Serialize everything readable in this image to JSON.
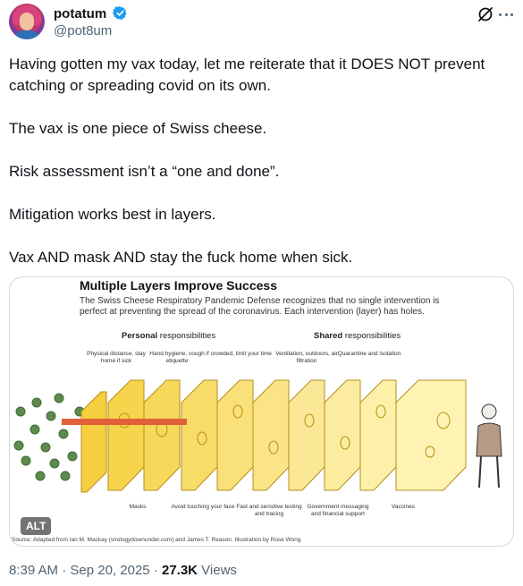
{
  "author": {
    "display_name": "potatum",
    "handle": "@pot8um",
    "verified_icon": "verified-badge-icon",
    "avatar_icon": "avatar"
  },
  "header_actions": {
    "grok_icon": "grok-icon",
    "more_icon": "more-options-icon"
  },
  "tweet": {
    "paragraphs": [
      "Having gotten my vax today, let me reiterate that it DOES NOT prevent catching or spreading covid on its own.",
      "The vax is one piece of Swiss cheese.",
      "Risk assessment isn’t a “one and done”.",
      "Mitigation works best in layers.",
      "Vax AND mask AND stay the fuck home when sick."
    ]
  },
  "media": {
    "alt_badge": "ALT",
    "title": "Multiple Layers Improve Success",
    "subtitle": "The Swiss Cheese Respiratory Pandemic Defense recognizes that no single intervention is perfect at preventing the spread of the coronavirus. Each intervention (layer) has holes.",
    "group_personal_bold": "Personal",
    "group_personal_rest": " responsibilities",
    "group_shared_bold": "Shared",
    "group_shared_rest": " responsibilities",
    "top_labels": [
      "Physical distance, stay home if sick",
      "Hand hygiene, cough etiquette",
      "If crowded, limit your time",
      "Ventilation, outdoors, air filtration",
      "Quarantine and isolation"
    ],
    "bottom_labels": [
      "Masks",
      "Avoid touching your face",
      "Fast and sensitive testing and tracing",
      "Government messaging and financial support",
      "Vaccines"
    ],
    "source": "Source: Adapted from Ian M. Mackay (virologydownunder.com) and James T. Reason. Illustration by Rose Wong"
  },
  "meta": {
    "time": "8:39 AM",
    "separator": " · ",
    "date": "Sep 20, 2025",
    "views_count": "27.3K",
    "views_label": " Views"
  },
  "colors": {
    "text": "#0f1419",
    "secondary": "#536471",
    "verified": "#1d9bf0",
    "border": "#cfd9de"
  }
}
